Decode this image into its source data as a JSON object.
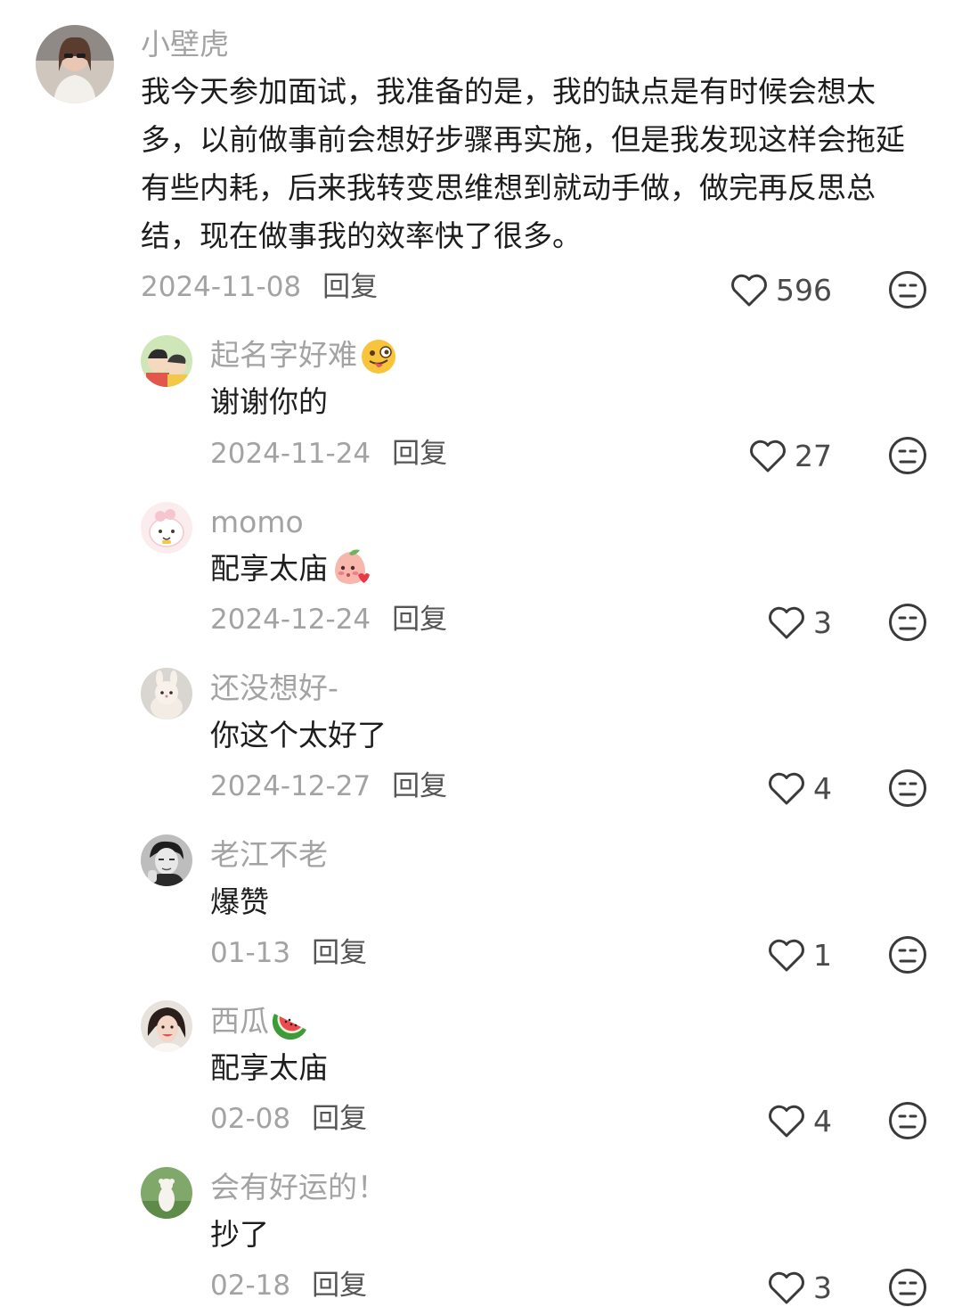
{
  "comments": [
    {
      "user": "小壁虎",
      "text": "我今天参加面试，我准备的是，我的缺点是有时候会想太多，以前做事前会想好步骤再实施，但是我发现这样会拖延有些内耗，后来我转变思维想到就动手做，做完再反思总结，现在做事我的效率快了很多。",
      "date": "2024-11-08",
      "reply_label": "回复",
      "likes": "596",
      "name_emoji": "",
      "text_emoji": ""
    },
    {
      "user": "起名字好难",
      "text": "谢谢你的",
      "date": "2024-11-24",
      "reply_label": "回复",
      "likes": "27",
      "name_emoji": "winking-tongue-emoji",
      "text_emoji": ""
    },
    {
      "user": "momo",
      "text": "配享太庙",
      "date": "2024-12-24",
      "reply_label": "回复",
      "likes": "3",
      "name_emoji": "",
      "text_emoji": "blushing-peach-emoji"
    },
    {
      "user": "还没想好-",
      "text": "你这个太好了",
      "date": "2024-12-27",
      "reply_label": "回复",
      "likes": "4",
      "name_emoji": "",
      "text_emoji": ""
    },
    {
      "user": "老江不老",
      "text": "爆赞",
      "date": "01-13",
      "reply_label": "回复",
      "likes": "1",
      "name_emoji": "",
      "text_emoji": ""
    },
    {
      "user": "西瓜",
      "text": "配享太庙",
      "date": "02-08",
      "reply_label": "回复",
      "likes": "4",
      "name_emoji": "watermelon-emoji",
      "text_emoji": ""
    },
    {
      "user": "会有好运的！",
      "text": "抄了",
      "date": "02-18",
      "reply_label": "回复",
      "likes": "3",
      "name_emoji": "",
      "text_emoji": ""
    }
  ],
  "icons": {
    "like": "heart-outline-icon",
    "dislike": "neutral-face-icon"
  },
  "colors": {
    "username": "#a3a3a3",
    "text": "#1d1d1d",
    "icon": "#3a3a3a"
  }
}
